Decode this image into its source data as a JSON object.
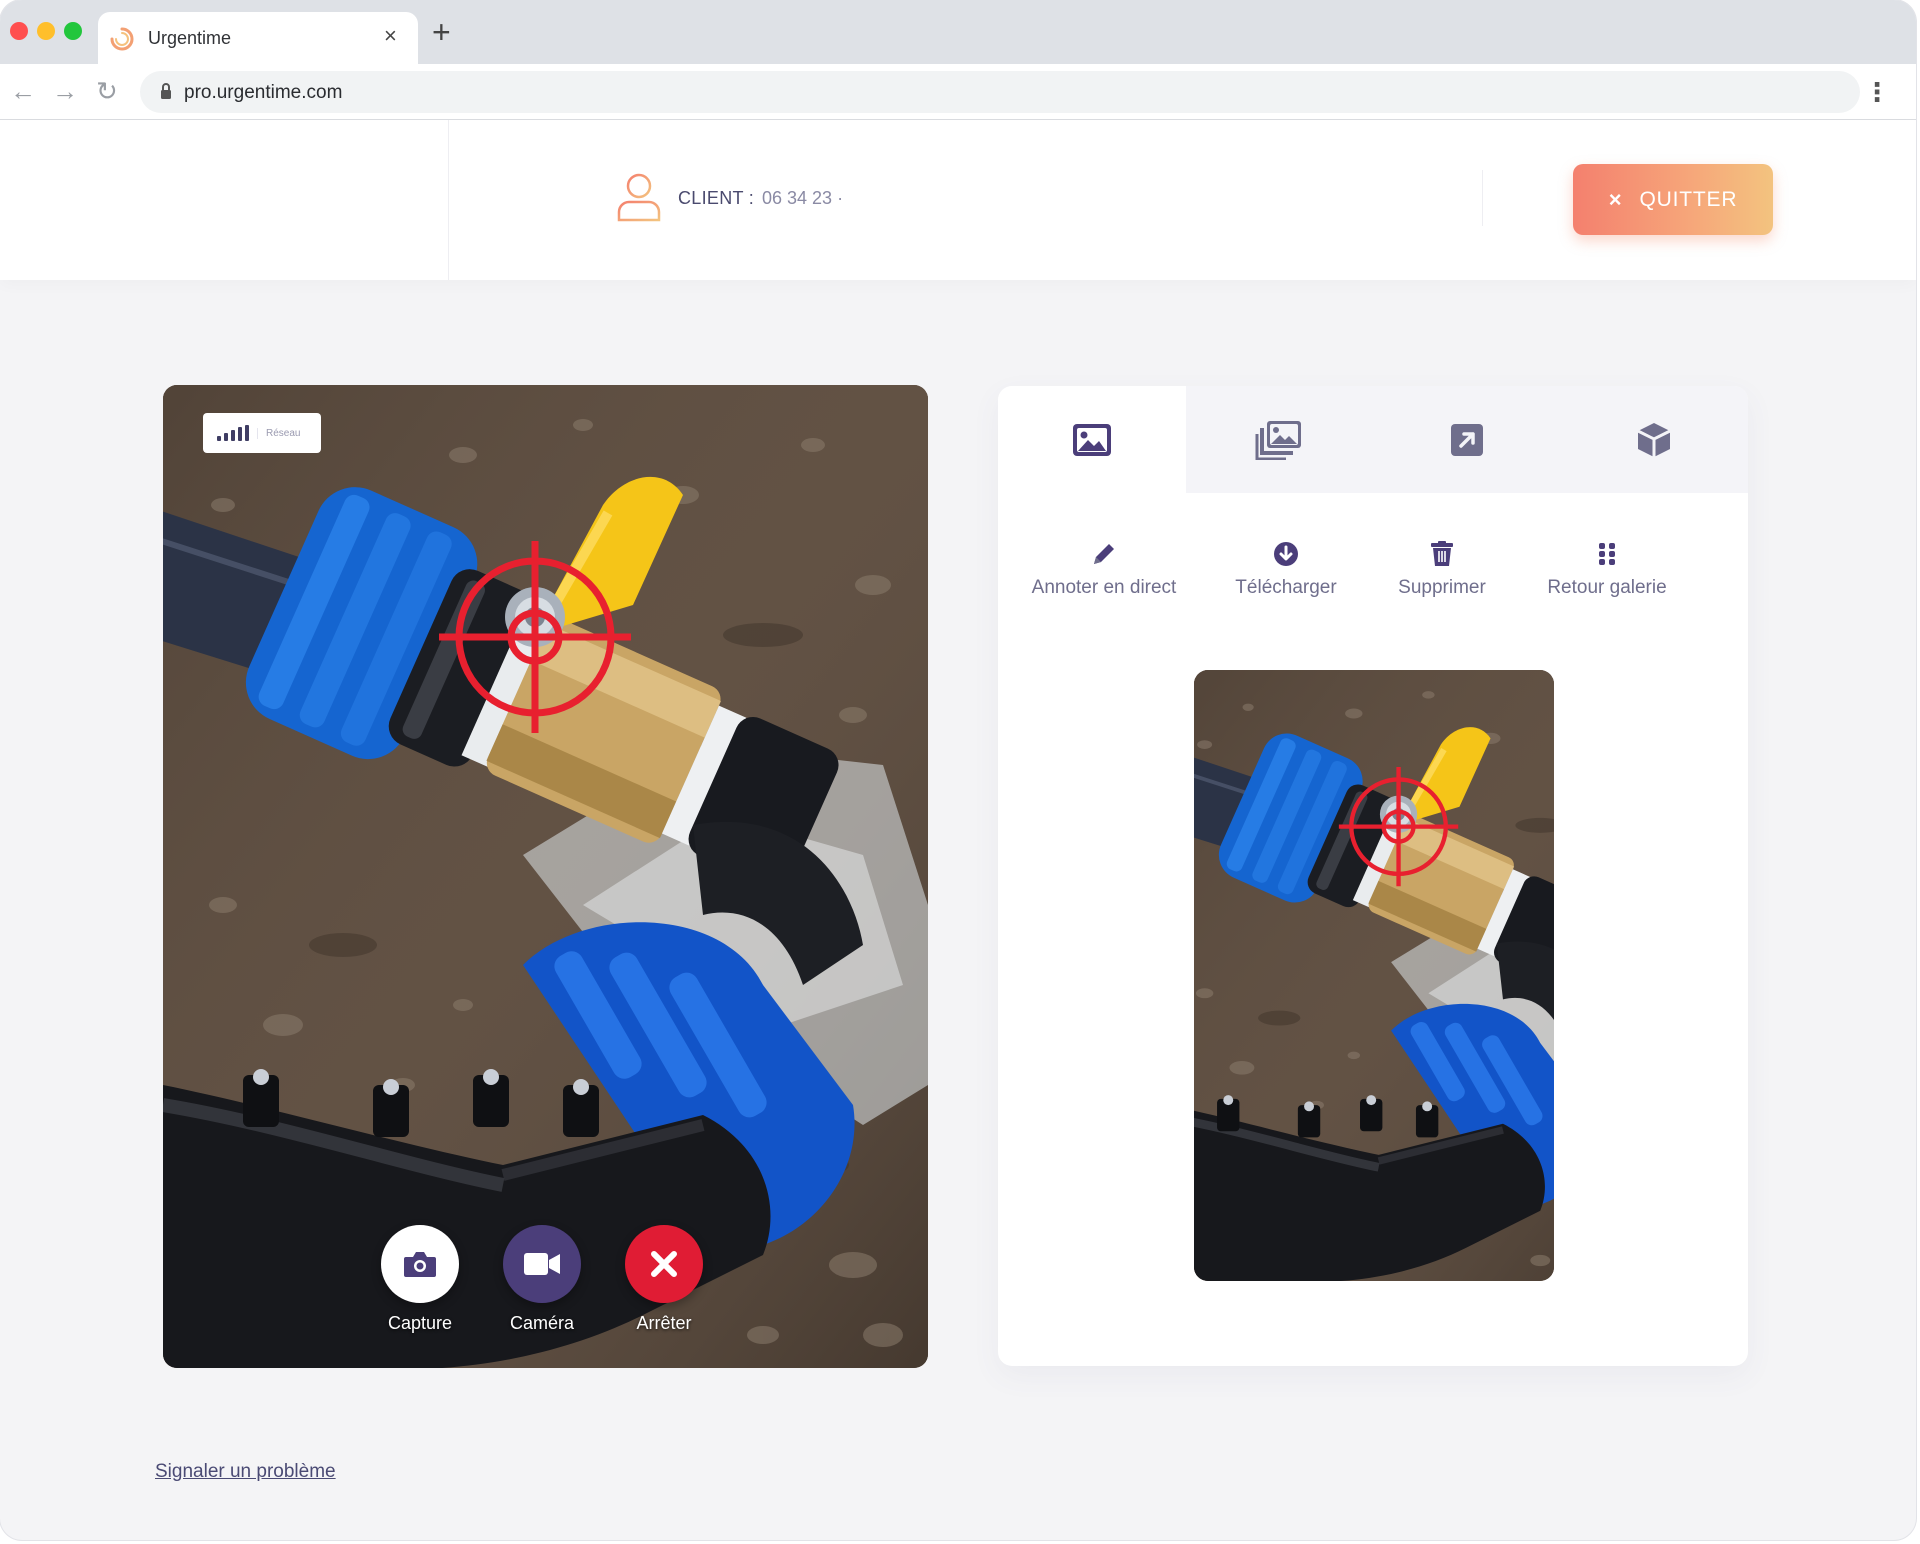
{
  "browser": {
    "tab_title": "Urgentime",
    "tab_close": "×",
    "new_tab": "+",
    "url": "pro.urgentime.com"
  },
  "header": {
    "client_label": "CLIENT :",
    "client_value": "06 34 23 ·",
    "quit_label": "QUITTER",
    "quit_icon": "×"
  },
  "video": {
    "signal_label": "Réseau",
    "controls": [
      {
        "label": "Capture",
        "icon": "camera-icon"
      },
      {
        "label": "Caméra",
        "icon": "video-camera-icon"
      },
      {
        "label": "Arrêter",
        "icon": "close-icon"
      }
    ]
  },
  "panel": {
    "tabs": [
      {
        "icon": "image-icon",
        "active": true
      },
      {
        "icon": "gallery-icon",
        "active": false
      },
      {
        "icon": "share-icon",
        "active": false
      },
      {
        "icon": "cube-icon",
        "active": false
      }
    ],
    "actions": [
      {
        "label": "Annoter en direct",
        "icon": "pencil-icon"
      },
      {
        "label": "Télécharger",
        "icon": "download-icon"
      },
      {
        "label": "Supprimer",
        "icon": "trash-icon"
      },
      {
        "label": "Retour galerie",
        "icon": "grid-icon"
      }
    ]
  },
  "footer": {
    "report_link": "Signaler un problème"
  },
  "colors": {
    "accent_purple": "#4b3e7a",
    "stop_red": "#e01c34",
    "quit_gradient_start": "#f4806e",
    "quit_gradient_end": "#f3c37f",
    "target_red": "#e8202f"
  }
}
